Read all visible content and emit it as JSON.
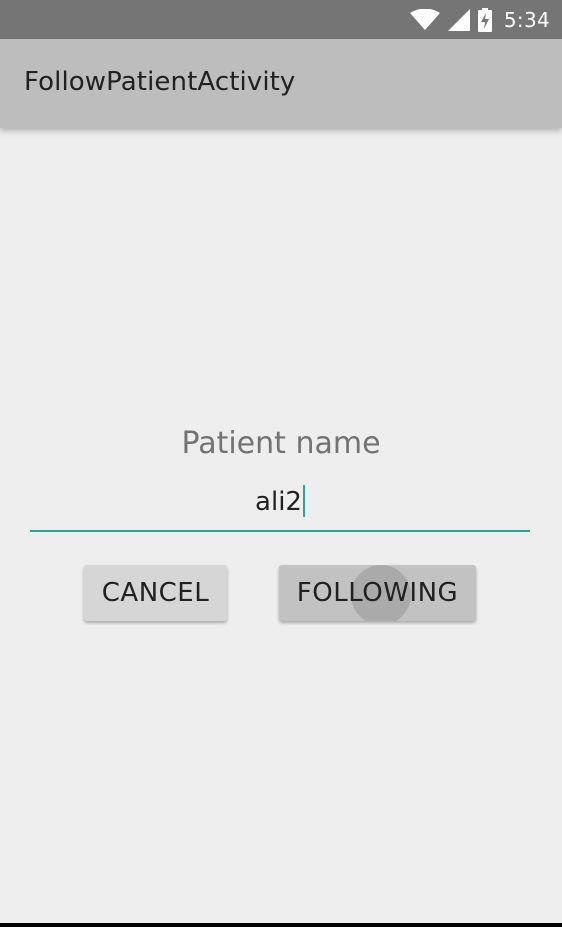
{
  "status_bar": {
    "time": "5:34",
    "icons": [
      "wifi-icon",
      "signal-icon",
      "battery-charging-icon"
    ],
    "color": "#757575"
  },
  "app_bar": {
    "title": "FollowPatientActivity",
    "color": "#bdbdbd"
  },
  "form": {
    "label": "Patient name",
    "input_value": "ali2",
    "accent_color": "#26a69a"
  },
  "buttons": {
    "cancel_label": "CANCEL",
    "following_label": "FOLLOWING"
  }
}
